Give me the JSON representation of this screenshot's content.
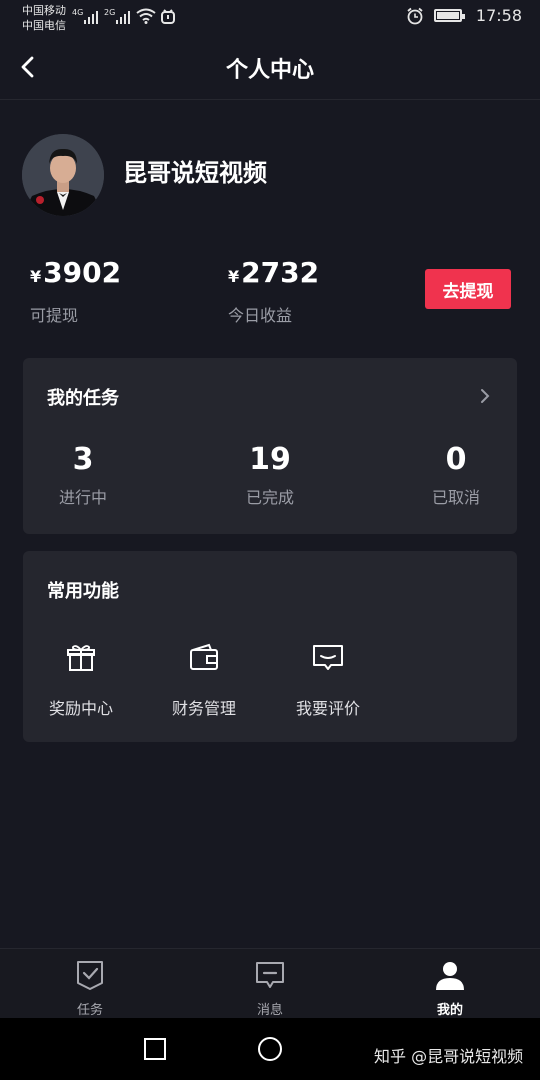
{
  "status_bar": {
    "carrier_1": "中国移动",
    "carrier_2": "中国电信",
    "net_1": "4G",
    "net_2": "2G",
    "time": "17:58"
  },
  "header": {
    "title": "个人中心"
  },
  "profile": {
    "name": "昆哥说短视频"
  },
  "balances": [
    {
      "currency": "¥",
      "amount": "3902",
      "label": "可提现"
    },
    {
      "currency": "¥",
      "amount": "2732",
      "label": "今日收益"
    }
  ],
  "withdraw_button": "去提现",
  "tasks": {
    "title": "我的任务",
    "stats": [
      {
        "value": "3",
        "label": "进行中"
      },
      {
        "value": "19",
        "label": "已完成"
      },
      {
        "value": "0",
        "label": "已取消"
      }
    ]
  },
  "functions": {
    "title": "常用功能",
    "items": [
      {
        "label": "奖励中心",
        "icon": "gift-icon"
      },
      {
        "label": "财务管理",
        "icon": "wallet-icon"
      },
      {
        "label": "我要评价",
        "icon": "comment-icon"
      }
    ]
  },
  "bottom_nav": [
    {
      "label": "任务",
      "icon": "task-icon",
      "active": false
    },
    {
      "label": "消息",
      "icon": "message-icon",
      "active": false
    },
    {
      "label": "我的",
      "icon": "user-icon",
      "active": true
    }
  ],
  "watermark": "知乎 @昆哥说短视频",
  "colors": {
    "background": "#171821",
    "card": "#25262e",
    "accent": "#f0334e"
  }
}
